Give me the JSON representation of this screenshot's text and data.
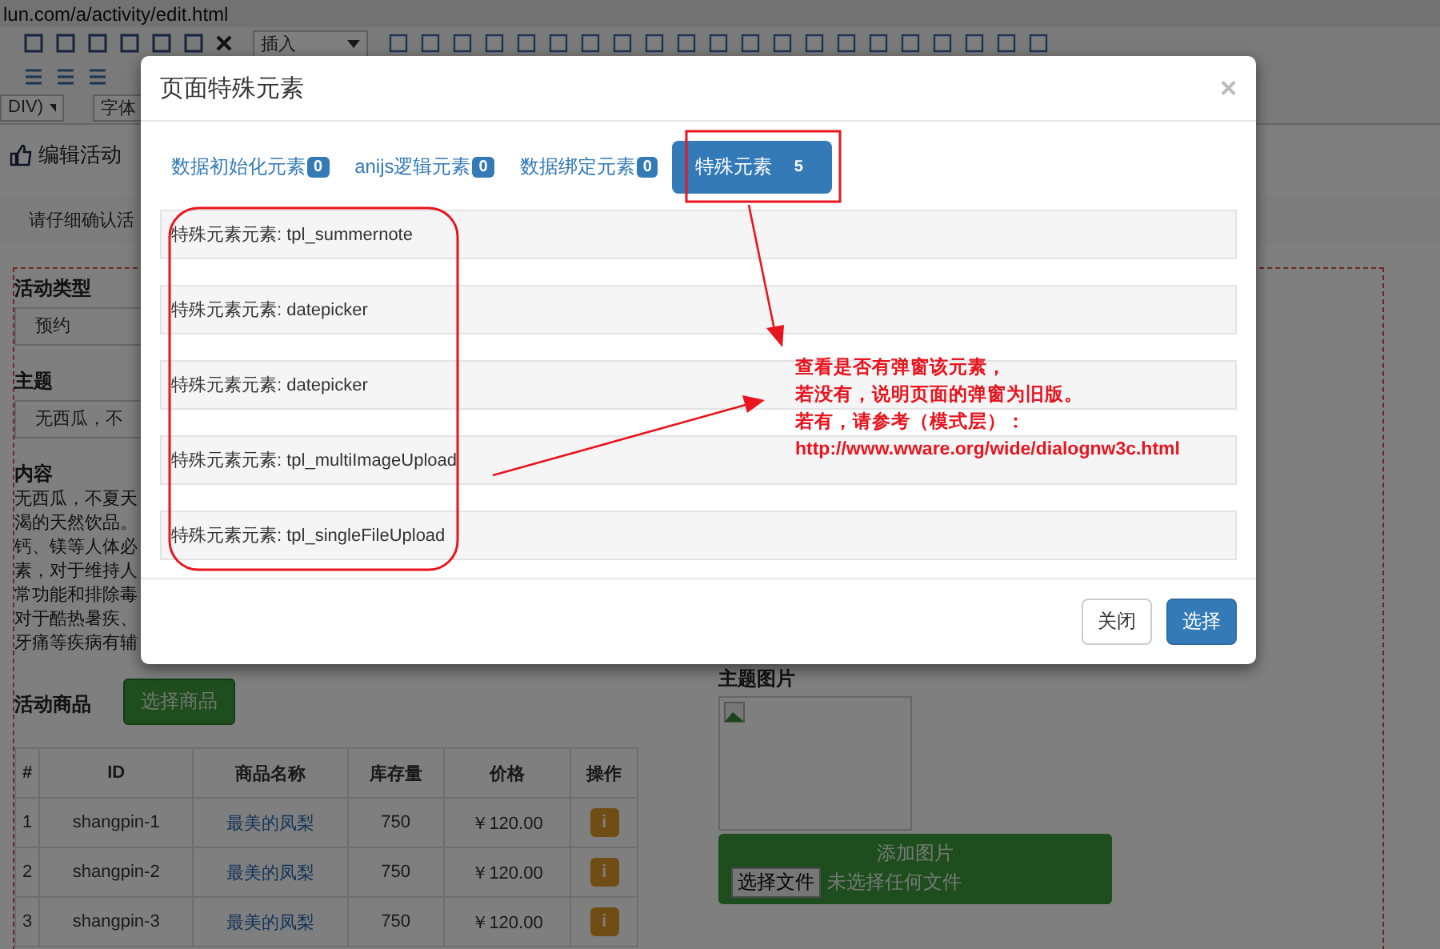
{
  "browser": {
    "url": "lun.com/a/activity/edit.html"
  },
  "toolbar": {
    "insert_dropdown": "插入",
    "format_dropdown": "DIV)",
    "font_dropdown": "字体"
  },
  "page": {
    "title": "编辑活动",
    "notice": "请仔细确认活",
    "form": {
      "type_label": "活动类型",
      "type_value": "预约",
      "subject_label": "主题",
      "subject_value": "无西瓜，不",
      "content_label": "内容",
      "content_lines": [
        "无西瓜，不夏天",
        "渴的天然饮品。",
        "钙、镁等人体必",
        "素，对于维持人",
        "常功能和排除毒",
        "对于酷热暑疾、",
        "牙痛等疾病有辅"
      ],
      "goods_label": "活动商品",
      "goods_button": "选择商品",
      "table": {
        "columns": [
          "#",
          "ID",
          "商品名称",
          "库存量",
          "价格",
          "操作"
        ],
        "rows": [
          {
            "index": "1",
            "id": "shangpin-1",
            "name": "最美的凤梨",
            "stock": "750",
            "price": "￥120.00",
            "action": "i"
          },
          {
            "index": "2",
            "id": "shangpin-2",
            "name": "最美的凤梨",
            "stock": "750",
            "price": "￥120.00",
            "action": "i"
          },
          {
            "index": "3",
            "id": "shangpin-3",
            "name": "最美的凤梨",
            "stock": "750",
            "price": "￥120.00",
            "action": "i"
          }
        ]
      },
      "image_label": "主题图片",
      "upload_title": "添加图片",
      "file_button": "选择文件",
      "file_status": "未选择任何文件"
    }
  },
  "modal": {
    "title": "页面特殊元素",
    "close": "×",
    "tabs": [
      {
        "label": "数据初始化元素",
        "count": "0",
        "selected": false
      },
      {
        "label": "anijs逻辑元素",
        "count": "0",
        "selected": false
      },
      {
        "label": "数据绑定元素",
        "count": "0",
        "selected": false
      },
      {
        "label": "特殊元素",
        "count": "5",
        "selected": true
      }
    ],
    "items": [
      "特殊元素元素: tpl_summernote",
      "特殊元素元素: datepicker",
      "特殊元素元素: datepicker",
      "特殊元素元素: tpl_multiImageUpload",
      "特殊元素元素: tpl_singleFileUpload"
    ],
    "buttons": [
      {
        "label": "关闭",
        "kind": "default"
      },
      {
        "label": "选择",
        "kind": "primary"
      }
    ]
  },
  "annotation": {
    "lines": [
      "查看是否有弹窗该元素，",
      "若没有，说明页面的弹窗为旧版。",
      "若有，请参考（模式层）：",
      "http://www.wware.org/wide/dialognw3c.html"
    ]
  }
}
